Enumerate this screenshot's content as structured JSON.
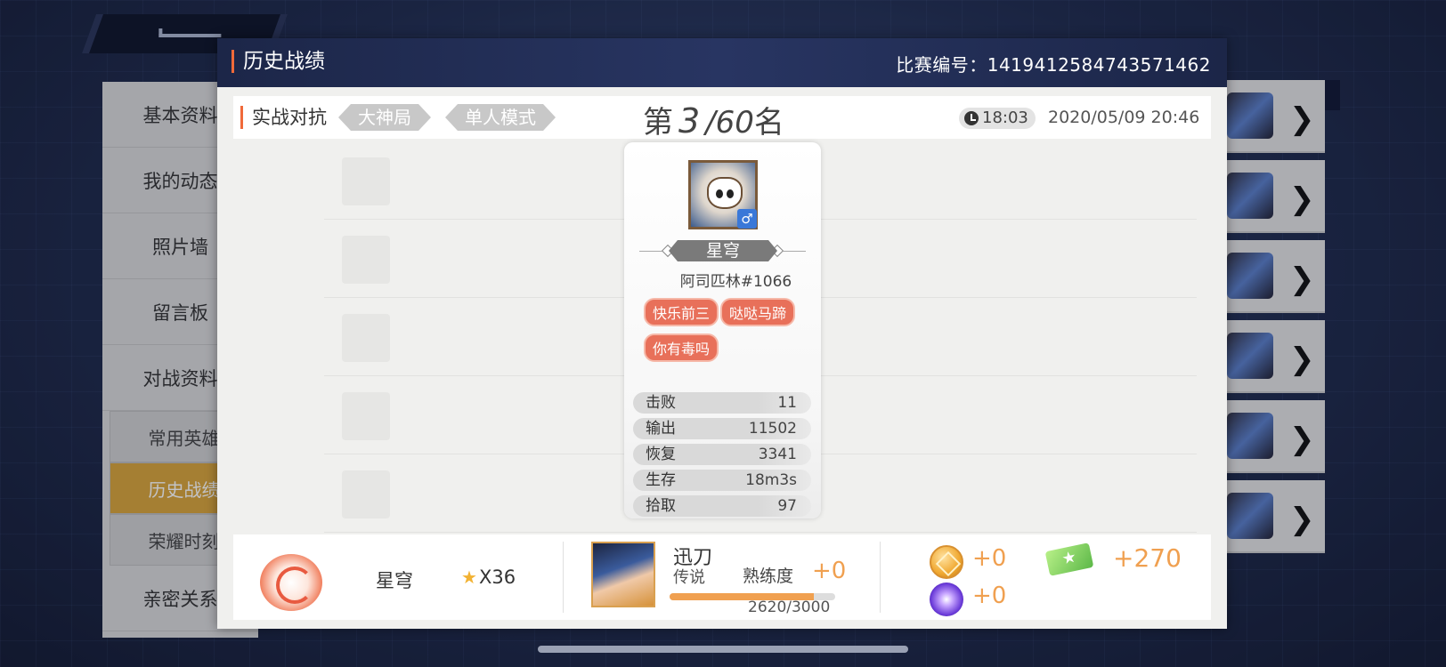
{
  "dialog": {
    "title": "历史战绩",
    "match_id": "比赛编号：1419412584743571462"
  },
  "info_bar": {
    "mode_label": "实战对抗",
    "tag_1": "大神局",
    "tag_2": "单人模式",
    "rank_prefix": "第",
    "rank_value": "3",
    "rank_total": "/60",
    "rank_suffix": "名",
    "duration": "18:03",
    "datetime": "2020/05/09 20:46"
  },
  "card": {
    "gender_symbol": "♂",
    "hero_name": "星穹",
    "player_id": "阿司匹林#1066",
    "badges": [
      "快乐前三",
      "哒哒马蹄",
      "你有毒吗"
    ],
    "stats": [
      {
        "label": "击败",
        "value": "11"
      },
      {
        "label": "输出",
        "value": "11502"
      },
      {
        "label": "恢复",
        "value": "3341"
      },
      {
        "label": "生存",
        "value": "18m3s"
      },
      {
        "label": "拾取",
        "value": "97"
      }
    ]
  },
  "rewards": {
    "rank_name": "星穹",
    "star_count": "X36",
    "hero": {
      "name": "迅刀",
      "rank": "传说",
      "proficiency_label": "熟练度",
      "proficiency_gain": "+0",
      "proficiency_progress": "2620/3000",
      "proficiency_fraction": 0.873
    },
    "coin_gain": "+0",
    "ticket_gain": "+270",
    "orb_gain": "+0"
  },
  "side_menu": {
    "items": [
      "基本资料",
      "我的动态",
      "照片墙",
      "留言板",
      "对战资料"
    ],
    "subitems": [
      "常用英雄",
      "历史战绩",
      "荣耀时刻"
    ],
    "last_item": "亲密关系"
  },
  "colors": {
    "accent": "#f06a3a",
    "title_bar": "#1c2648",
    "badge": "#e8705a",
    "reward_text": "#f0a050",
    "active_menu": "#d8a53a"
  }
}
